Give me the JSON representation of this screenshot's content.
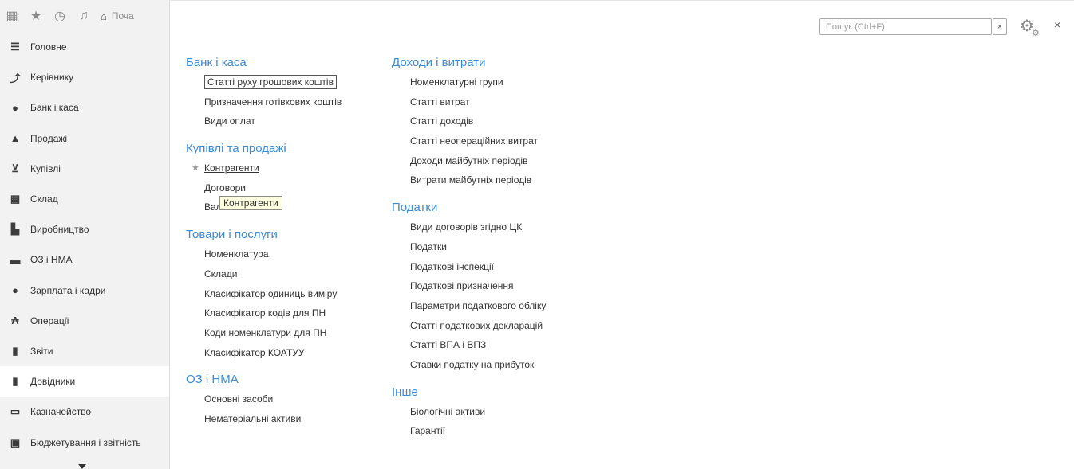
{
  "toolbar": {
    "icons": [
      "apps-grid-icon",
      "star-icon",
      "history-icon",
      "bell-icon"
    ],
    "home_label": "Поча"
  },
  "sidebar": {
    "items": [
      {
        "label": "Головне",
        "icon": "menu-lines-icon"
      },
      {
        "label": "Керівнику",
        "icon": "trend-chart-icon"
      },
      {
        "label": "Банк і каса",
        "icon": "bank-coin-icon"
      },
      {
        "label": "Продажі",
        "icon": "shopping-bag-icon"
      },
      {
        "label": "Купівлі",
        "icon": "cart-icon"
      },
      {
        "label": "Склад",
        "icon": "warehouse-icon"
      },
      {
        "label": "Виробництво",
        "icon": "factory-icon"
      },
      {
        "label": "ОЗ і НМА",
        "icon": "truck-icon"
      },
      {
        "label": "Зарплата і кадри",
        "icon": "person-icon"
      },
      {
        "label": "Операції",
        "icon": "operations-icon"
      },
      {
        "label": "Звіти",
        "icon": "bar-chart-icon"
      },
      {
        "label": "Довідники",
        "icon": "books-icon"
      },
      {
        "label": "Казначейство",
        "icon": "money-icon"
      },
      {
        "label": "Бюджетування і звітність",
        "icon": "calculator-icon"
      }
    ],
    "active_index": 11
  },
  "search": {
    "placeholder": "Пошук (Ctrl+F)",
    "value": "",
    "clear": "×"
  },
  "header": {
    "close": "×"
  },
  "left_column": [
    {
      "title": "Банк і каса",
      "items": [
        "Статті руху грошових коштів",
        "Призначення готівкових коштів",
        "Види оплат"
      ]
    },
    {
      "title": "Купівлі та продажі",
      "items": [
        "Контрагенти",
        "Договори",
        "Валюти"
      ]
    },
    {
      "title": "Товари і послуги",
      "items": [
        "Номенклатура",
        "Склади",
        "Класифікатор одиниць виміру",
        "Класифікатор кодів для ПН",
        "Коди номенклатури для ПН",
        "Класифікатор КОАТУУ"
      ]
    },
    {
      "title": "ОЗ і НМА",
      "items": [
        "Основні засоби",
        "Нематеріальні активи"
      ]
    }
  ],
  "right_column": [
    {
      "title": "Доходи і витрати",
      "items": [
        "Номенклатурні групи",
        "Статті витрат",
        "Статті доходів",
        "Статті неопераційних витрат",
        "Доходи майбутніх періодів",
        "Витрати майбутніх періодів"
      ]
    },
    {
      "title": "Податки",
      "items": [
        "Види договорів згідно ЦК",
        "Податки",
        "Податкові інспекції",
        "Податкові призначення",
        "Параметри податкового обліку",
        "Статті податкових декларацій",
        "Статті ВПА і ВПЗ",
        "Ставки податку на прибуток"
      ]
    },
    {
      "title": "Інше",
      "items": [
        "Біологічні активи",
        "Гарантії"
      ]
    }
  ],
  "tooltip": "Контрагенти"
}
